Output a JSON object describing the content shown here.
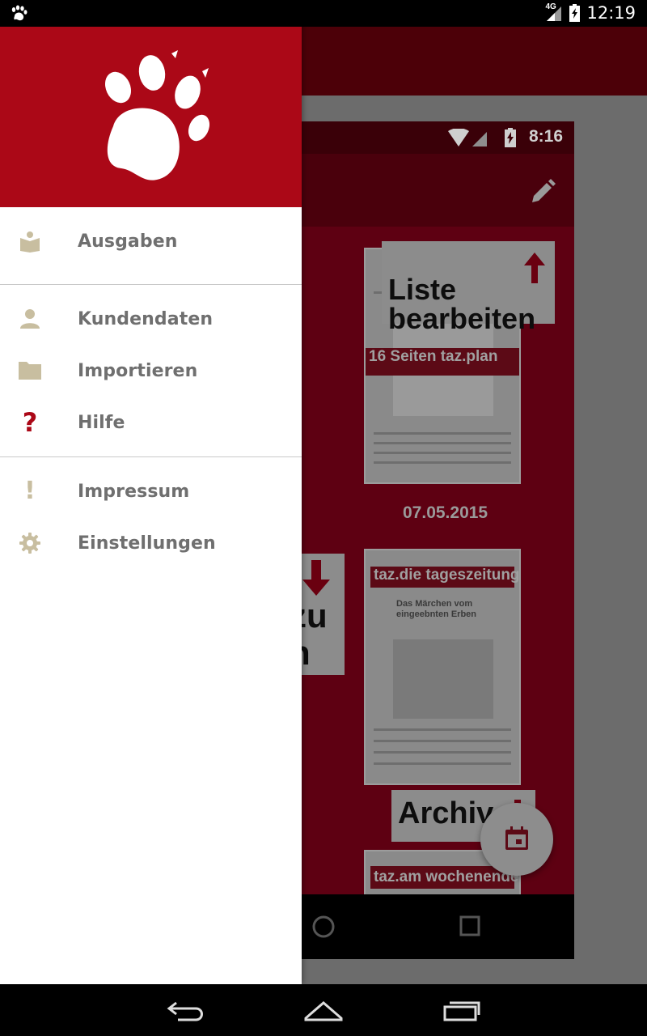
{
  "status_bar": {
    "time": "12:19",
    "network": "4G",
    "app_icon": "paw-icon"
  },
  "drawer": {
    "logo": "paw-logo",
    "groups": [
      [
        {
          "label": "Ausgaben",
          "icon": "book-icon",
          "icon_color": "#c8bea0"
        }
      ],
      [
        {
          "label": "Kundendaten",
          "icon": "person-icon",
          "icon_color": "#c8bea0"
        },
        {
          "label": "Importieren",
          "icon": "folder-icon",
          "icon_color": "#c8bea0"
        },
        {
          "label": "Hilfe",
          "icon": "question-icon",
          "icon_color": "#ab0817"
        }
      ],
      [
        {
          "label": "Impressum",
          "icon": "exclamation-icon",
          "icon_color": "#c8bea0"
        },
        {
          "label": "Einstellungen",
          "icon": "gear-icon",
          "icon_color": "#c8bea0"
        }
      ]
    ]
  },
  "background": {
    "phone_time": "8:16",
    "callouts": {
      "edit_list": "Liste\nbearbeiten",
      "archive": "Archiv",
      "partial_line1": "zu",
      "partial_line2": "n"
    },
    "papers": [
      {
        "masthead": "",
        "banner": "16 Seiten taz.plan",
        "date": "07.05.2015"
      },
      {
        "masthead": "taz.die tageszeitung",
        "headline": "Das Märchen vom eingeebnten Erben"
      },
      {
        "masthead": "taz.am wochenende"
      }
    ]
  },
  "colors": {
    "brand": "#ab0817",
    "icon": "#c8bea0",
    "text": "#6f6f6f"
  },
  "nav_bar": {
    "back": "back-icon",
    "home": "home-icon",
    "recents": "recents-icon"
  }
}
